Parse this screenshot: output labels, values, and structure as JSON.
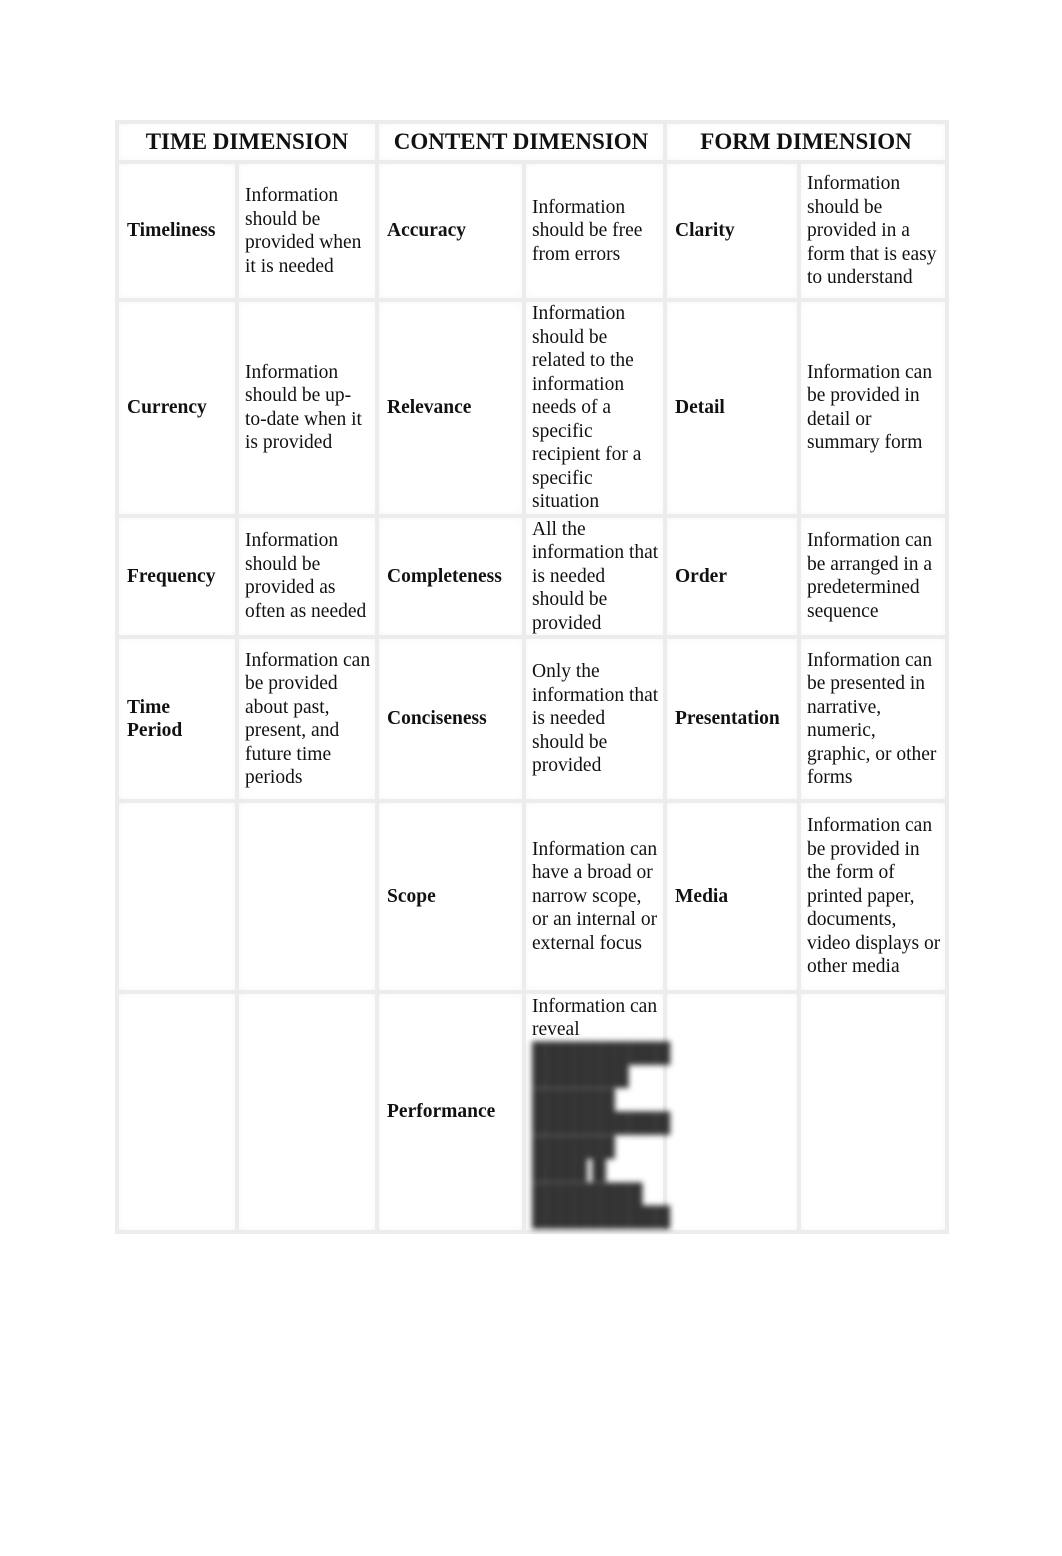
{
  "table": {
    "headers": {
      "time": "TIME DIMENSION",
      "content": "CONTENT DIMENSION",
      "form": "FORM DIMENSION"
    },
    "rows": [
      {
        "time_term": "Timeliness",
        "time_desc": "Information should be provided when it is needed",
        "content_term": "Accuracy",
        "content_desc": "Information should be free from errors",
        "form_term": "Clarity",
        "form_desc": "Information should be provided in a form that is easy to understand"
      },
      {
        "time_term": "Currency",
        "time_desc": "Information should be up-to-date when it is provided",
        "content_term": "Relevance",
        "content_desc": "Information should be related to the information needs of a specific recipient for a specific situation",
        "form_term": "Detail",
        "form_desc": "Information can be provided in detail or summary form"
      },
      {
        "time_term": "Frequency",
        "time_desc": "Information should be provided as often as needed",
        "content_term": "Completeness",
        "content_desc": "All the information that is needed should be provided",
        "form_term": "Order",
        "form_desc": "Information can be arranged in a predetermined sequence"
      },
      {
        "time_term": "Time Period",
        "time_desc": "Information can be provided about past, present, and future time periods",
        "content_term": "Conciseness",
        "content_desc": "Only the information that is needed should be provided",
        "form_term": "Presentation",
        "form_desc": "Information can be presented in narrative, numeric, graphic, or other forms"
      },
      {
        "time_term": "",
        "time_desc": "",
        "content_term": "Scope",
        "content_desc": "Information can have a broad or narrow scope, or an internal or external focus",
        "form_term": "Media",
        "form_desc": "Information can be provided in the form of printed paper, documents, video displays or other media"
      },
      {
        "time_term": "",
        "time_desc": "",
        "content_term": "Performance",
        "content_desc": "Information can reveal",
        "form_term": "",
        "form_desc": ""
      }
    ]
  }
}
